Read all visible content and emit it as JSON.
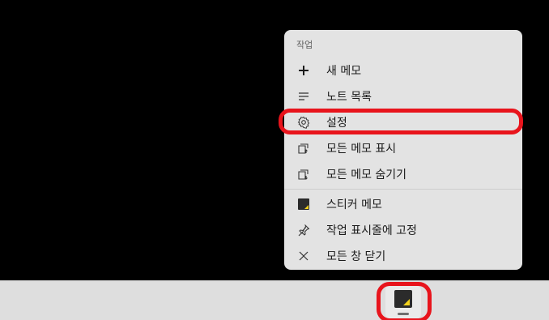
{
  "menu": {
    "header": "작업",
    "items": [
      {
        "label": "새 메모",
        "icon": "plus-icon"
      },
      {
        "label": "노트 목록",
        "icon": "list-icon"
      },
      {
        "label": "설정",
        "icon": "gear-icon"
      },
      {
        "label": "모든 메모 표시",
        "icon": "show-all-notes-icon"
      },
      {
        "label": "모든 메모 숨기기",
        "icon": "hide-all-notes-icon"
      },
      {
        "label": "스티커 메모",
        "icon": "sticky-notes-app-icon"
      },
      {
        "label": "작업 표시줄에 고정",
        "icon": "pin-icon"
      },
      {
        "label": "모든 창 닫기",
        "icon": "close-icon"
      }
    ]
  },
  "taskbar": {
    "app_icon": "sticky-notes-app-icon"
  },
  "colors": {
    "highlight": "#e8141c",
    "menu_bg": "#e3e3e3",
    "app_accent": "#f3d21b"
  }
}
